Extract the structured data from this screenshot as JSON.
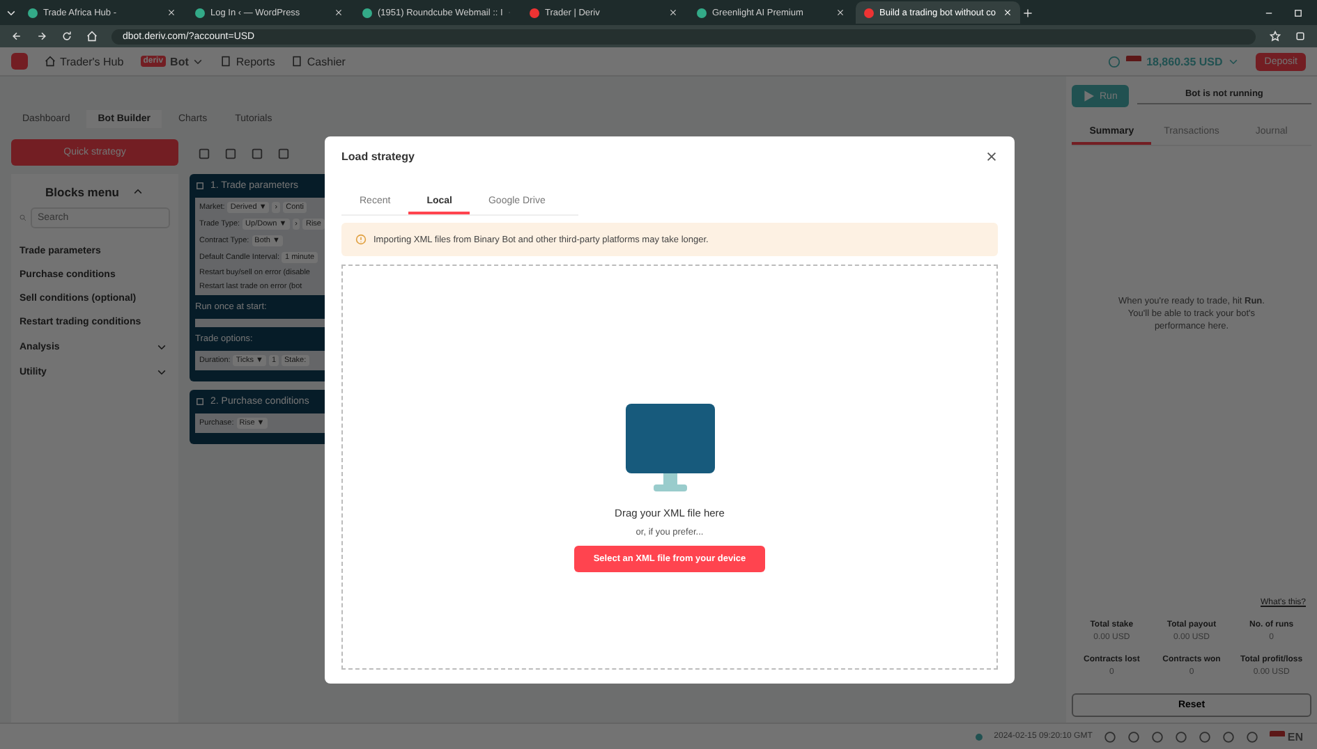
{
  "browser": {
    "tabs": [
      {
        "title": "Trade Africa Hub -",
        "selected": false
      },
      {
        "title": "Log In ‹ — WordPress",
        "selected": false
      },
      {
        "title": "(1951) Roundcube Webmail :: I",
        "selected": false
      },
      {
        "title": "Trader | Deriv",
        "selected": false
      },
      {
        "title": "Greenlight AI Premium",
        "selected": false
      },
      {
        "title": "Build a trading bot without co",
        "selected": true
      }
    ],
    "address": "dbot.deriv.com/?account=USD"
  },
  "header": {
    "nav": [
      "Trader's Hub",
      "Reports",
      "Cashier"
    ],
    "product": "Bot",
    "logo": "deriv",
    "balance": "18,860.35 USD",
    "deposit": "Deposit"
  },
  "subnav": [
    {
      "label": "Dashboard",
      "selected": false
    },
    {
      "label": "Bot Builder",
      "selected": true
    },
    {
      "label": "Charts",
      "selected": false
    },
    {
      "label": "Tutorials",
      "selected": false
    }
  ],
  "sidebar": {
    "quick_strategy": "Quick strategy",
    "title": "Blocks menu",
    "search": {
      "placeholder": "Search"
    },
    "items": [
      {
        "label": "Trade parameters",
        "expandable": false
      },
      {
        "label": "Purchase conditions",
        "expandable": false
      },
      {
        "label": "Sell conditions (optional)",
        "expandable": false
      },
      {
        "label": "Restart trading conditions",
        "expandable": false
      },
      {
        "label": "Analysis",
        "expandable": true
      },
      {
        "label": "Utility",
        "expandable": true
      }
    ]
  },
  "blocks": [
    {
      "title": "1. Trade parameters",
      "rows": [
        {
          "label": "Market:",
          "options": [
            "Derived ▼",
            "›",
            "Conti"
          ]
        },
        {
          "label": "Trade Type:",
          "options": [
            "Up/Down ▼",
            "›",
            "Rise"
          ]
        },
        {
          "label": "Contract Type:",
          "options": [
            "Both ▼"
          ]
        },
        {
          "label": "Default Candle Interval:",
          "options": [
            "1 minute"
          ]
        },
        {
          "label": "Restart buy/sell on error (disable"
        },
        {
          "label": "Restart last trade on error (bot"
        }
      ],
      "sections": [
        {
          "title": "Run once at start:"
        },
        {
          "title": "Trade options:",
          "rows": [
            {
              "label": "Duration:",
              "options": [
                "Ticks ▼",
                "1",
                "Stake:"
              ]
            }
          ]
        }
      ]
    },
    {
      "title": "2. Purchase conditions",
      "rows": [
        {
          "label": "Purchase:",
          "options": [
            "Rise ▼"
          ]
        }
      ]
    }
  ],
  "run_panel": {
    "run": "Run",
    "status": "Bot is not running",
    "tabs": [
      {
        "label": "Summary",
        "selected": true
      },
      {
        "label": "Transactions",
        "selected": false
      },
      {
        "label": "Journal",
        "selected": false
      }
    ],
    "message": "When you're ready to trade, hit **Run**. You'll be able to track your bot's performance here.",
    "whats_this": "What's this?",
    "stats": [
      {
        "label": "Total stake",
        "value": "0.00 USD"
      },
      {
        "label": "Total payout",
        "value": "0.00 USD"
      },
      {
        "label": "No. of runs",
        "value": "0"
      },
      {
        "label": "Contracts lost",
        "value": "0"
      },
      {
        "label": "Contracts won",
        "value": "0"
      },
      {
        "label": "Total profit/loss",
        "value": "0.00 USD"
      }
    ],
    "reset": "Reset"
  },
  "footer": {
    "time": "2024-02-15 09:20:10 GMT",
    "language": "EN"
  },
  "modal": {
    "title": "Load strategy",
    "tabs": [
      {
        "label": "Recent",
        "selected": false
      },
      {
        "label": "Local",
        "selected": true
      },
      {
        "label": "Google Drive",
        "selected": false
      }
    ],
    "notice": "Importing XML files from Binary Bot and other third-party platforms may take longer.",
    "drop_text": "Drag your XML file here",
    "alt_text": "or, if you prefer...",
    "button": "Select an XML file from your device"
  }
}
